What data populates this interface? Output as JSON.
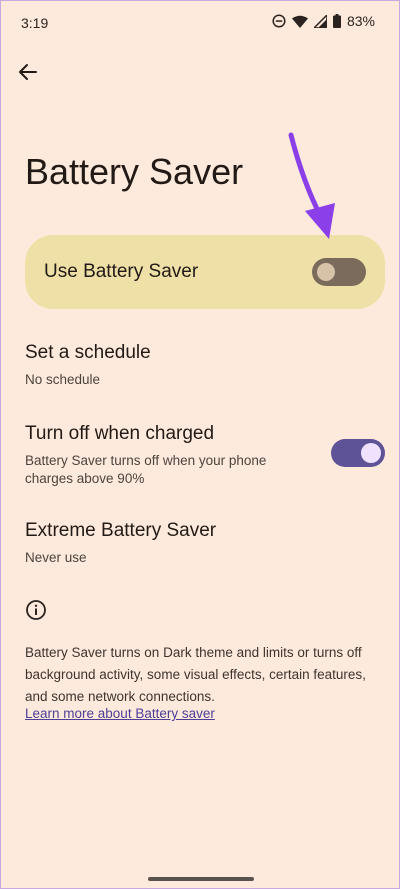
{
  "status_bar": {
    "time": "3:19",
    "battery_percent": "83%"
  },
  "header": {
    "back_icon": "arrow-left-icon",
    "title": "Battery Saver"
  },
  "main_toggle": {
    "label": "Use Battery Saver",
    "state": "off"
  },
  "settings": [
    {
      "title": "Set a schedule",
      "subtitle": "No schedule"
    },
    {
      "title": "Turn off when charged",
      "subtitle": "Battery Saver turns off when your phone charges above 90%",
      "toggle_state": "on"
    },
    {
      "title": "Extreme Battery Saver",
      "subtitle": "Never use"
    }
  ],
  "info": {
    "icon": "info-icon",
    "text": "Battery Saver turns on Dark theme and limits or turns off background activity, some visual effects, certain features, and some network connections.",
    "link": "Learn more about Battery saver"
  },
  "colors": {
    "background": "#fdeadc",
    "card": "#efe0a7",
    "toggle_on": "#5e5396",
    "toggle_off": "#7a6b5d",
    "link": "#4c3f96",
    "annotation_arrow": "#8b3fe8"
  }
}
